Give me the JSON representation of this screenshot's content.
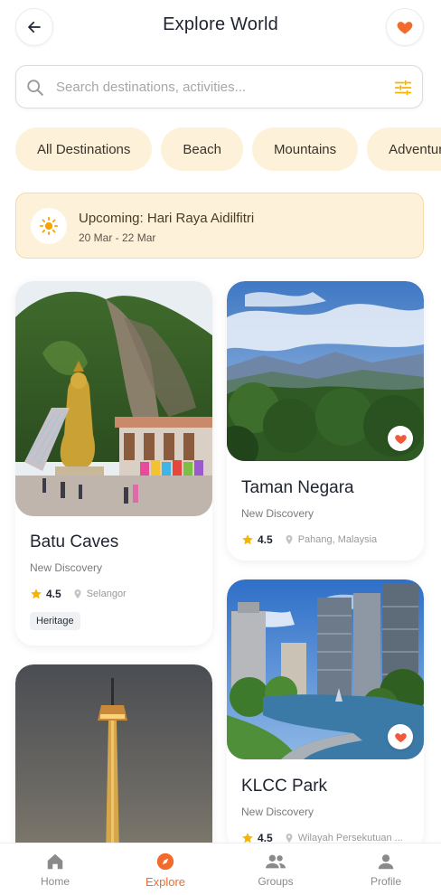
{
  "header": {
    "title": "Explore World"
  },
  "search": {
    "placeholder": "Search destinations, activities..."
  },
  "chips": [
    {
      "label": "All Destinations"
    },
    {
      "label": "Beach"
    },
    {
      "label": "Mountains"
    },
    {
      "label": "Adventure"
    }
  ],
  "banner": {
    "title": "Upcoming: Hari Raya Aidilfitri",
    "date": "20 Mar - 22 Mar"
  },
  "cards": {
    "batu": {
      "title": "Batu Caves",
      "subtitle": "New Discovery",
      "rating": "4.5",
      "location": "Selangor",
      "tag": "Heritage"
    },
    "taman": {
      "title": "Taman Negara",
      "subtitle": "New Discovery",
      "rating": "4.5",
      "location": "Pahang, Malaysia"
    },
    "klcc": {
      "title": "KLCC Park",
      "subtitle": "New Discovery",
      "rating": "4.5",
      "location": "Wilayah Persekutuan ..."
    }
  },
  "nav": [
    {
      "label": "Home"
    },
    {
      "label": "Explore"
    },
    {
      "label": "Groups"
    },
    {
      "label": "Profile"
    }
  ],
  "colors": {
    "accent": "#f26b2c",
    "heart": "#f05a3c",
    "chip_bg": "#fdf1d9",
    "banner_bg": "#fdf2d9",
    "star": "#f5b400"
  }
}
